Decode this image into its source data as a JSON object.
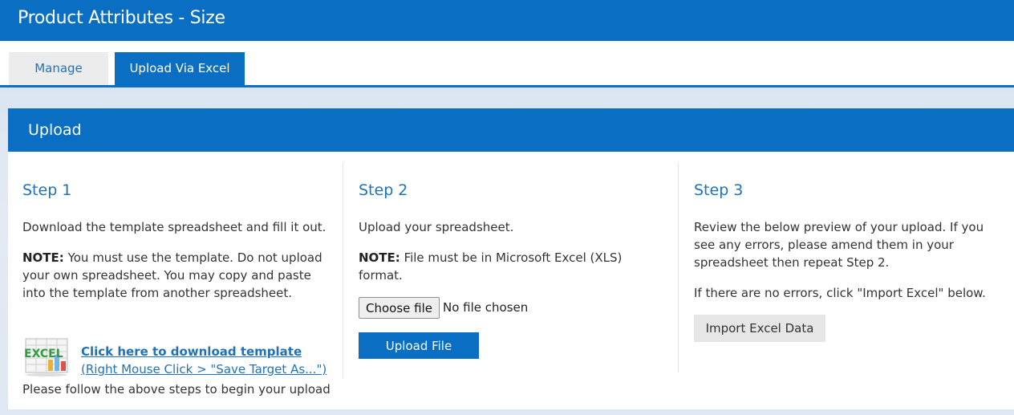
{
  "header": {
    "title": "Product Attributes - Size"
  },
  "tabs": [
    {
      "label": "Manage",
      "active": false
    },
    {
      "label": "Upload Via Excel",
      "active": true
    }
  ],
  "panel": {
    "title": "Upload"
  },
  "step1": {
    "title": "Step 1",
    "intro": "Download the template spreadsheet and fill it out.",
    "note_label": "NOTE:",
    "note_text": " You must use the template. Do not upload your own spreadsheet. You may copy and paste into the template from another spreadsheet.",
    "excel_icon_text": "EXCEL",
    "download_link": "Click here to download template",
    "download_hint": "(Right Mouse Click > \"Save Target As...\")",
    "follow_text": "Please follow the above steps to begin your upload"
  },
  "step2": {
    "title": "Step 2",
    "intro": "Upload your spreadsheet.",
    "note_label": "NOTE:",
    "note_text": " File must be in Microsoft Excel (XLS) format.",
    "choose_file_label": "Choose file",
    "no_file_text": "No file chosen",
    "upload_button": "Upload File"
  },
  "step3": {
    "title": "Step 3",
    "intro": "Review the below preview of your upload. If you see any errors, please amend them in your spreadsheet then repeat Step 2.",
    "no_errors_text": "If there are no errors, click \"Import Excel\" below.",
    "import_button": "Import Excel Data"
  },
  "colors": {
    "brand_blue": "#0a6fc2",
    "link_blue": "#1f72b8",
    "excel_green": "#2e9e3e"
  }
}
